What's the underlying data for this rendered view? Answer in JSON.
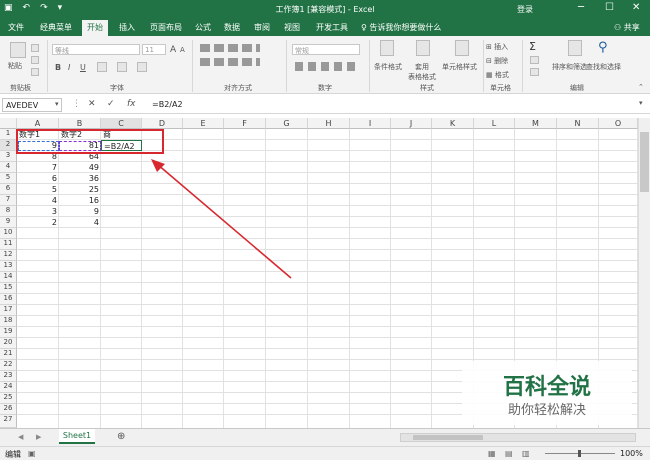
{
  "window": {
    "title": "工作簿1 [兼容模式] - Excel",
    "login": "登录",
    "minimize": "─",
    "restore": "☐",
    "close": "✕",
    "qat": [
      "▣",
      "↶",
      "↷",
      "▾"
    ]
  },
  "tabs": [
    "文件",
    "经典菜单",
    "开始",
    "插入",
    "页面布局",
    "公式",
    "数据",
    "审阅",
    "视图",
    "开发工具"
  ],
  "tell_me": "告诉我你想要做什么",
  "share": "共享",
  "ribbon": {
    "paste": "粘贴",
    "clipboard": "剪贴板",
    "font_name": "等线",
    "font_size": "11",
    "bold": "B",
    "italic": "I",
    "underline": "U",
    "font_grow": "A",
    "font_shrink": "A",
    "font_group": "字体",
    "align_group": "对齐方式",
    "number_format": "常规",
    "number_group": "数字",
    "cond_format": "条件格式",
    "table_format": "套用\n表格格式",
    "cell_style": "单元格样式",
    "style_group": "样式",
    "insert": "插入",
    "delete": "删除",
    "format": "格式",
    "cells_group": "单元格",
    "autosum": "Σ",
    "sort_filter": "排序和筛选",
    "find_select": "查找和选择",
    "edit_group": "编辑"
  },
  "formula_bar": {
    "name_box": "AVEDEV",
    "cancel": "✕",
    "enter": "✓",
    "fx": "fx",
    "formula": "=B2/A2"
  },
  "columns": [
    "A",
    "B",
    "C",
    "D",
    "E",
    "F",
    "G",
    "H",
    "I",
    "J",
    "K",
    "L",
    "M",
    "N",
    "O"
  ],
  "rows": [
    "1",
    "2",
    "3",
    "4",
    "5",
    "6",
    "7",
    "8",
    "9",
    "10",
    "11",
    "12",
    "13",
    "14",
    "15",
    "16",
    "17",
    "18",
    "19",
    "20",
    "21",
    "22",
    "23",
    "24",
    "25",
    "26",
    "27"
  ],
  "cells": {
    "A1": "数字1",
    "B1": "数字2",
    "C1": "商",
    "A2": "9",
    "B2": "81",
    "C2": "=B2/A2",
    "A3": "8",
    "B3": "64",
    "A4": "7",
    "B4": "49",
    "A5": "6",
    "B5": "36",
    "A6": "5",
    "B6": "25",
    "A7": "4",
    "B7": "16",
    "A8": "3",
    "B8": "9",
    "A9": "2",
    "B9": "4"
  },
  "sheet": {
    "name": "Sheet1",
    "add": "⊕",
    "prev": "◀",
    "next": "▶"
  },
  "status": {
    "mode": "编辑",
    "zoom": "100%"
  },
  "watermark": {
    "title": "百科全说",
    "subtitle": "助你轻松解决"
  },
  "colors": {
    "accent": "#217346",
    "annotation": "#d8282f"
  }
}
